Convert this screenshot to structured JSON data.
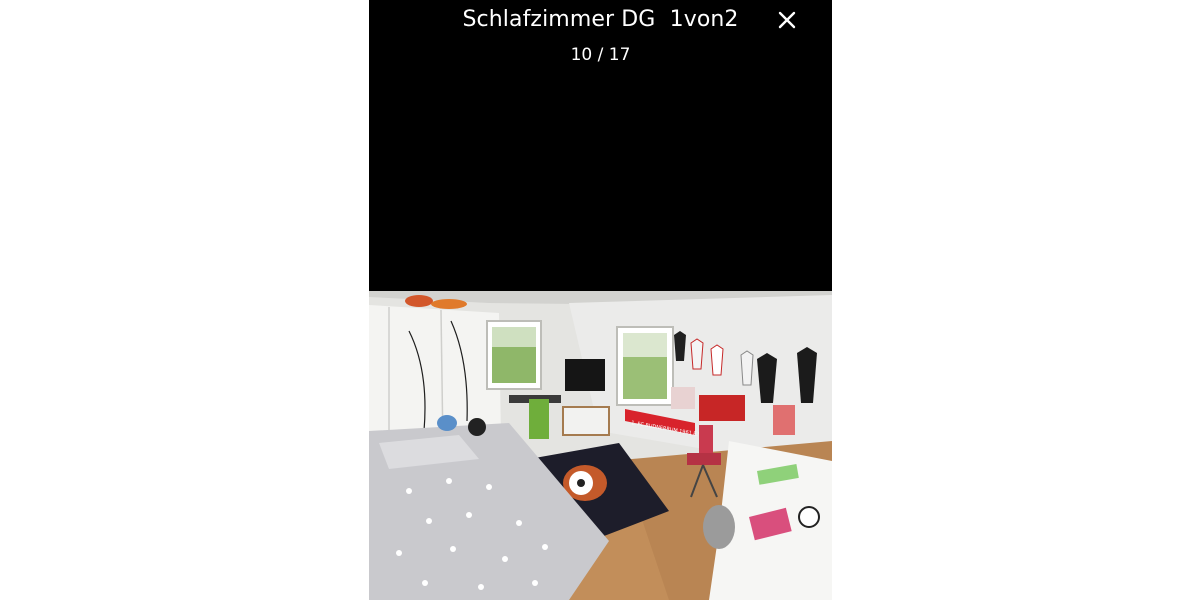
{
  "viewer": {
    "title": "Schlafzimmer DG  1von2",
    "counter": "10 / 17",
    "close_icon": "close-icon"
  },
  "photo": {
    "scene": "bedroom",
    "banner_text": "1. FC BUDNERRUM 1961 E.V."
  }
}
